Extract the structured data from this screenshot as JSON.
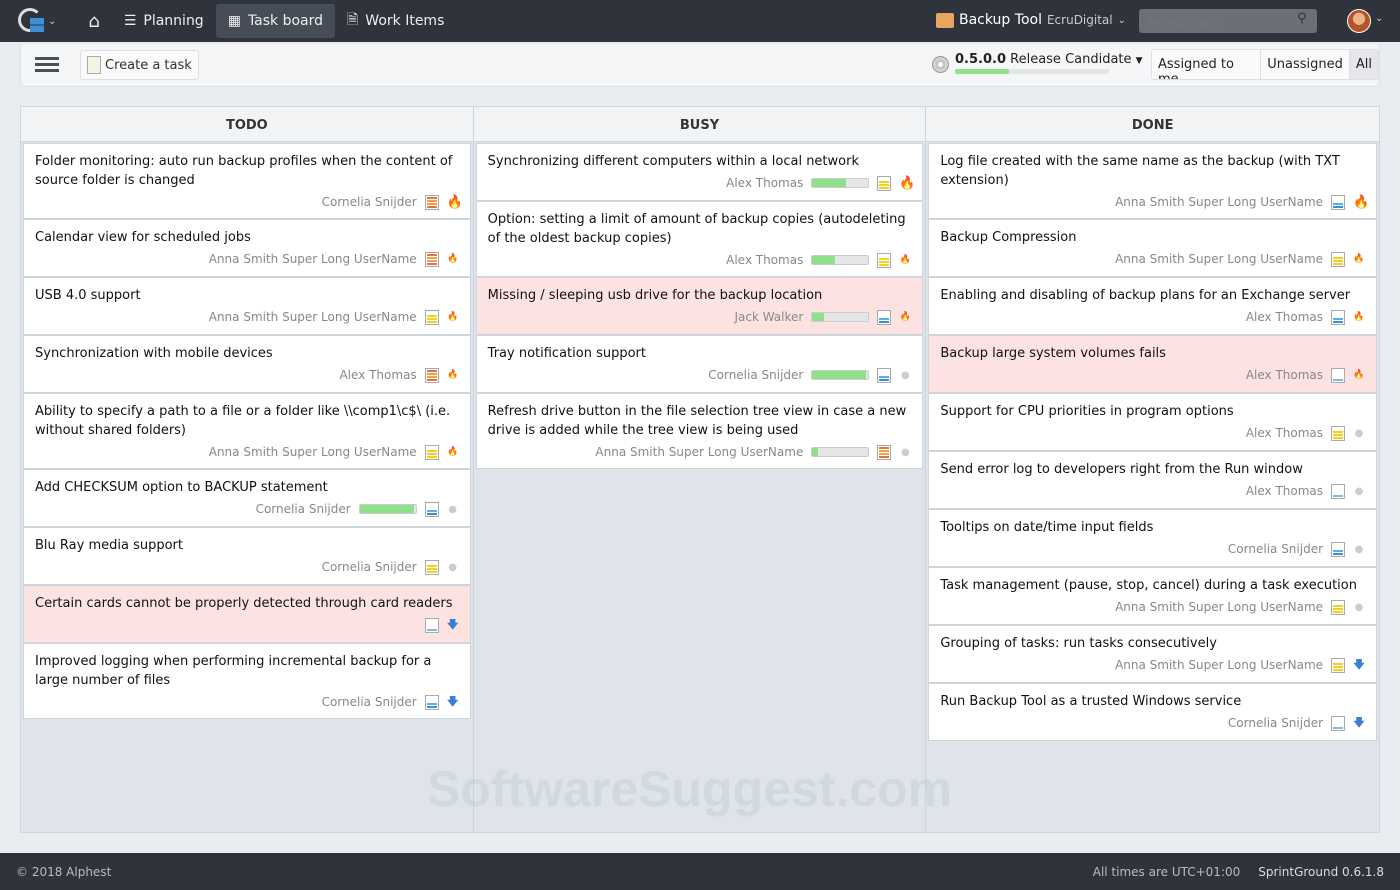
{
  "nav": {
    "items": [
      {
        "label": "Planning"
      },
      {
        "label": "Task board"
      },
      {
        "label": "Work Items"
      }
    ],
    "project": "Backup Tool",
    "company": "EcruDigital",
    "search_placeholder": "Search items"
  },
  "toolbar": {
    "create_label": "Create a task",
    "release_version": "0.5.0.0",
    "release_name": "Release Candidate",
    "release_progress": 0.35,
    "filters": [
      "Assigned to me",
      "Unassigned",
      "All"
    ],
    "active_filter": "All"
  },
  "colors": {
    "accent": "#8fe08a",
    "pink": "#fde2e2",
    "nav": "#2f343c"
  },
  "columns": [
    {
      "name": "TODO",
      "cards": [
        {
          "title": "Folder monitoring: auto run backup profiles when the content of source folder is changed",
          "assignee": "Cornelia Snijder",
          "type": "orange",
          "priority": "high"
        },
        {
          "title": "Calendar view for scheduled jobs",
          "assignee": "Anna Smith Super Long UserName",
          "type": "orange",
          "priority": "medium"
        },
        {
          "title": "USB 4.0 support",
          "assignee": "Anna Smith Super Long UserName",
          "type": "yellow",
          "priority": "medium"
        },
        {
          "title": "Synchronization with mobile devices",
          "assignee": "Alex Thomas",
          "type": "orange",
          "priority": "medium"
        },
        {
          "title": "Ability to specify a path to a file or a folder like \\\\comp1\\c$\\ (i.e. without shared folders)",
          "assignee": "Anna Smith Super Long UserName",
          "type": "yellow",
          "priority": "medium"
        },
        {
          "title": "Add CHECKSUM option to BACKUP statement",
          "assignee": "Cornelia Snijder",
          "progress": 0.97,
          "type": "blue",
          "priority": "low"
        },
        {
          "title": "Blu Ray media support",
          "assignee": "Cornelia Snijder",
          "type": "yellow",
          "priority": "low"
        },
        {
          "title": "Certain cards cannot be properly detected through card readers",
          "assignee": "",
          "type": "white",
          "priority": "lowest",
          "highlight": true
        },
        {
          "title": "Improved logging when performing incremental backup for a large number of files",
          "assignee": "Cornelia Snijder",
          "type": "blue",
          "priority": "lowest"
        }
      ]
    },
    {
      "name": "BUSY",
      "cards": [
        {
          "title": "Synchronizing different computers within a local network",
          "assignee": "Alex Thomas",
          "progress": 0.6,
          "type": "yellow",
          "priority": "high"
        },
        {
          "title": "Option: setting a limit of amount of backup copies (autodeleting of the oldest backup copies)",
          "assignee": "Alex Thomas",
          "progress": 0.4,
          "type": "yellow",
          "priority": "medium"
        },
        {
          "title": "Missing / sleeping usb drive for the backup location",
          "assignee": "Jack Walker",
          "progress": 0.2,
          "type": "blue",
          "priority": "medium",
          "highlight": true
        },
        {
          "title": "Tray notification support",
          "assignee": "Cornelia Snijder",
          "progress": 0.95,
          "type": "blue",
          "priority": "low"
        },
        {
          "title": "Refresh drive button in the file selection tree view in case a new drive is added while the tree view is being used",
          "assignee": "Anna Smith Super Long UserName",
          "progress": 0.1,
          "type": "orange",
          "priority": "low"
        }
      ]
    },
    {
      "name": "DONE",
      "cards": [
        {
          "title": "Log file created with the same name as the backup (with TXT extension)",
          "assignee": "Anna Smith Super Long UserName",
          "type": "blue",
          "priority": "high"
        },
        {
          "title": "Backup Compression",
          "assignee": "Anna Smith Super Long UserName",
          "type": "yellow",
          "priority": "medium"
        },
        {
          "title": "Enabling and disabling of backup plans for an Exchange server",
          "assignee": "Alex Thomas",
          "type": "blue",
          "priority": "medium"
        },
        {
          "title": "Backup large system volumes fails",
          "assignee": "Alex Thomas",
          "type": "white",
          "priority": "medium",
          "highlight": true
        },
        {
          "title": "Support for CPU priorities in program options",
          "assignee": "Alex Thomas",
          "type": "yellow",
          "priority": "low"
        },
        {
          "title": "Send error log to developers right from the Run window",
          "assignee": "Alex Thomas",
          "type": "white",
          "priority": "low"
        },
        {
          "title": "Tooltips on date/time input fields",
          "assignee": "Cornelia Snijder",
          "type": "blue",
          "priority": "low"
        },
        {
          "title": "Task management (pause, stop, cancel) during a task execution",
          "assignee": "Anna Smith Super Long UserName",
          "type": "yellow",
          "priority": "low"
        },
        {
          "title": "Grouping of tasks: run tasks consecutively",
          "assignee": "Anna Smith Super Long UserName",
          "type": "yellow",
          "priority": "lowest"
        },
        {
          "title": "Run Backup Tool as a trusted Windows service",
          "assignee": "Cornelia Snijder",
          "type": "white",
          "priority": "lowest"
        }
      ]
    }
  ],
  "footer": {
    "copyright": "© 2018 Alphest",
    "timezone": "All times are UTC+01:00",
    "version": "SprintGround 0.6.1.8"
  },
  "watermark": "SoftwareSuggest.com"
}
